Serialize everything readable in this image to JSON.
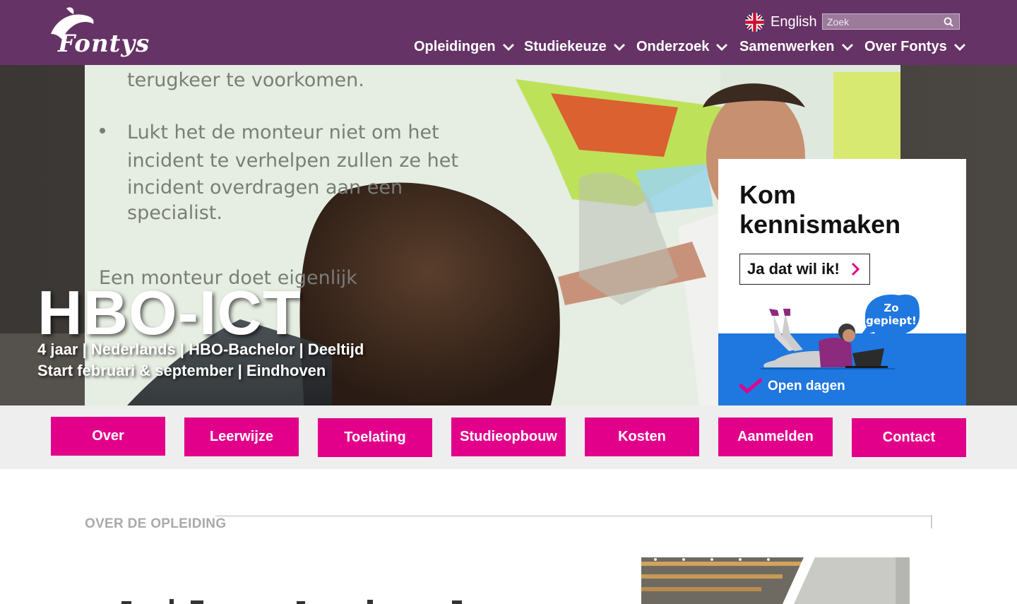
{
  "header": {
    "logo_text": "Fontys",
    "language_label": "English",
    "search_placeholder": "Zoek",
    "nav": [
      {
        "label": "Opleidingen"
      },
      {
        "label": "Studiekeuze"
      },
      {
        "label": "Onderzoek"
      },
      {
        "label": "Samenwerken"
      },
      {
        "label": "Over Fontys"
      }
    ]
  },
  "hero": {
    "title": "HBO-ICT",
    "subtitle_line1": "4 jaar | Nederlands  | HBO-Bachelor | Deeltijd",
    "subtitle_line2": "Start februari & september  | Eindhoven",
    "slide_text_1": "terugkeer te voorkomen.",
    "slide_text_2": "Lukt het de monteur niet om het",
    "slide_text_3": "incident te verhelpen zullen ze het",
    "slide_text_4": "incident overdragen aan een",
    "slide_text_5": "specialist.",
    "slide_text_6": "Een monteur doet eigenlijk"
  },
  "promo": {
    "title": "Kom kennismaken",
    "button_label": "Ja dat wil ik!",
    "bubble_text_1": "Zo",
    "bubble_text_2": "gepiept!",
    "link_label": "Open dagen"
  },
  "tabs": [
    {
      "label": "Over"
    },
    {
      "label": "Leerwijze"
    },
    {
      "label": "Toelating"
    },
    {
      "label": "Studieopbouw"
    },
    {
      "label": "Kosten"
    },
    {
      "label": "Aanmelden"
    },
    {
      "label": "Contact"
    }
  ],
  "content": {
    "section_label": "OVER DE OPLEIDING"
  },
  "colors": {
    "header_bg": "#663366",
    "accent_pink": "#e2008a",
    "promo_blue": "#1f77e0",
    "tabbar_bg": "#eeeeee"
  }
}
